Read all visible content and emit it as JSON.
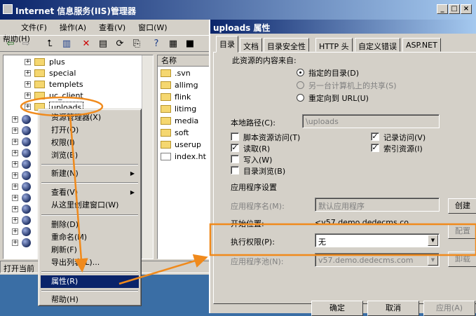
{
  "main_window": {
    "title": "Internet 信息服务(IIS)管理器",
    "menu": [
      "文件(F)",
      "操作(A)",
      "查看(V)",
      "窗口(W)",
      "帮助(H)"
    ],
    "controls": [
      "_",
      "□",
      "×"
    ]
  },
  "tree": {
    "nodes": [
      "plus",
      "special",
      "templets",
      "uc_client",
      "uploads"
    ],
    "selected": "uploads"
  },
  "list": {
    "header": "名称",
    "items": [
      ".svn",
      "allimg",
      "flink",
      "litimg",
      "media",
      "soft",
      "userup",
      "index.ht"
    ]
  },
  "status_bar": "打开当前",
  "context_menu": {
    "items": [
      "资源管理器(X)",
      "打开(O)",
      "权限(I)",
      "浏览(B)",
      "新建(N)",
      "查看(V)",
      "从这里创建窗口(W)",
      "删除(D)",
      "重命名(M)",
      "刷新(F)",
      "导出列表(L)...",
      "属性(R)",
      "帮助(H)"
    ],
    "selected": "属性(R)"
  },
  "dialog": {
    "title": "uploads 属性",
    "tabs": [
      "目录",
      "文档",
      "目录安全性",
      "HTTP 头",
      "自定义错误",
      "ASP.NET"
    ],
    "active_tab": "目录",
    "content_source_label": "此资源的内容来自:",
    "radios": [
      "指定的目录(D)",
      "另一台计算机上的共享(S)",
      "重定向到 URL(U)"
    ],
    "selected_radio": "指定的目录(D)",
    "local_path_label": "本地路径(C):",
    "local_path_value": "\\uploads",
    "checkboxes": [
      {
        "label": "脚本资源访问(T)",
        "checked": false
      },
      {
        "label": "读取(R)",
        "checked": true
      },
      {
        "label": "写入(W)",
        "checked": false
      },
      {
        "label": "目录浏览(B)",
        "checked": false
      },
      {
        "label": "记录访问(V)",
        "checked": true
      },
      {
        "label": "索引资源(I)",
        "checked": true
      }
    ],
    "app_settings_title": "应用程序设置",
    "app_name_label": "应用程序名(M):",
    "app_name_value": "默认应用程序",
    "start_point_label": "开始位置:",
    "start_point_value": "<v57.demo.dedecms.co...",
    "exec_perm_label": "执行权限(P):",
    "exec_perm_value": "无",
    "app_pool_label": "应用程序池(N):",
    "app_pool_value": "v57.demo.dedecms.com",
    "side_buttons": [
      "创建",
      "配置",
      "卸载"
    ],
    "bottom_buttons": [
      "确定",
      "取消",
      "应用(A)"
    ]
  }
}
